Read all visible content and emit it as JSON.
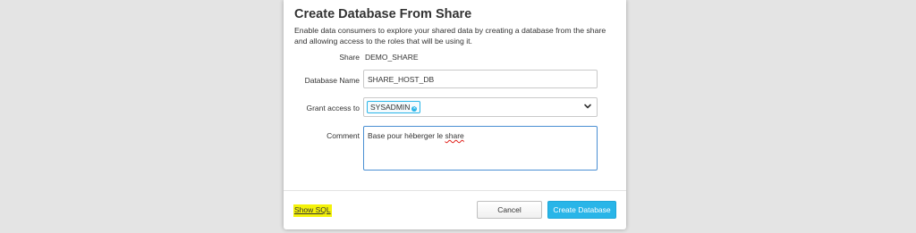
{
  "dialog": {
    "title": "Create Database From Share",
    "description": "Enable data consumers to explore your shared data by creating a database from the share and allowing access to the roles that will be using it."
  },
  "form": {
    "share": {
      "label": "Share",
      "value": "DEMO_SHARE"
    },
    "database_name": {
      "label": "Database Name",
      "value": "SHARE_HOST_DB"
    },
    "grant_access": {
      "label": "Grant access to",
      "selected_roles": [
        "SYSADMIN"
      ],
      "remove_icon": "close-icon",
      "dropdown_icon": "chevron-down-icon"
    },
    "comment": {
      "label": "Comment",
      "value_prefix": "Base pour hèberger le ",
      "value_misspelled_word": "share"
    }
  },
  "footer": {
    "show_sql_label": "Show SQL",
    "cancel_label": "Cancel",
    "create_label": "Create Database"
  },
  "colors": {
    "accent": "#29b5e8",
    "highlight": "#f4f20a",
    "focus_border": "#4a8fd3",
    "backdrop": "#e4e4e4"
  }
}
